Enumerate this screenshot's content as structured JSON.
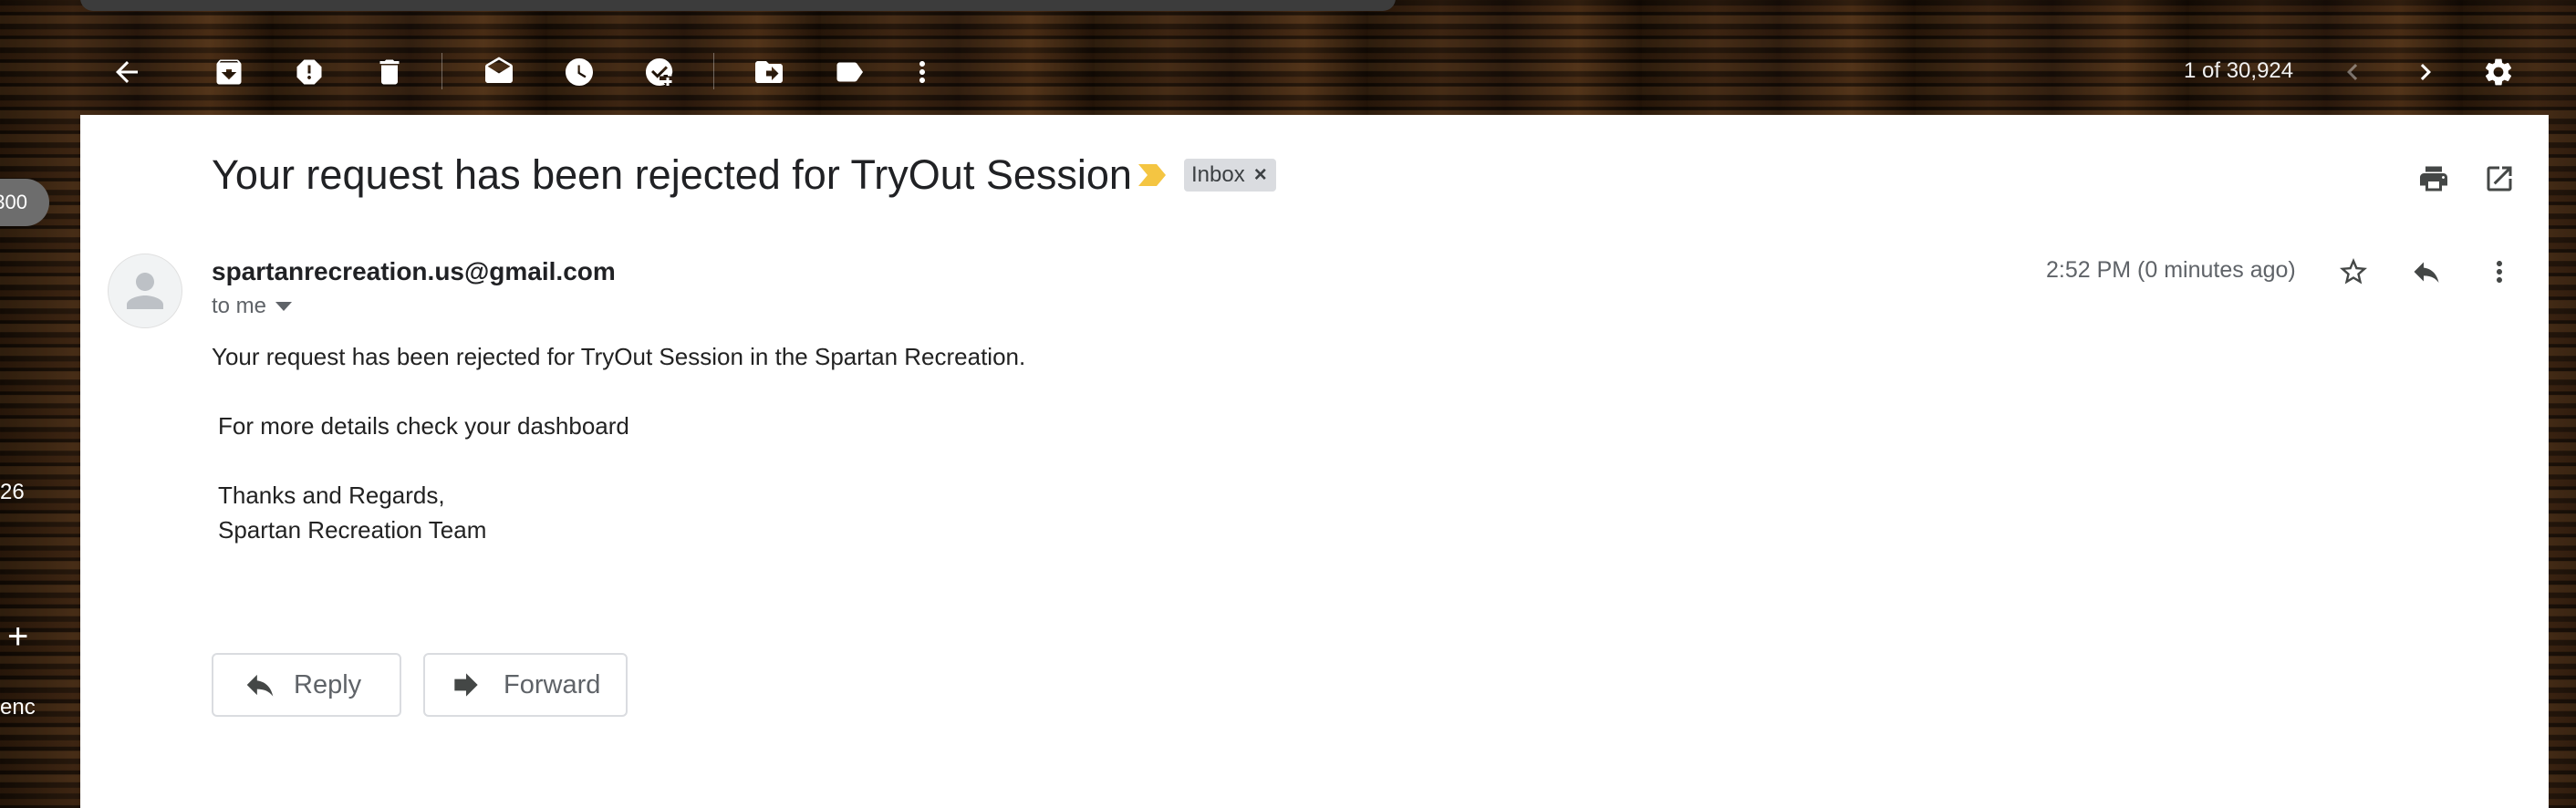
{
  "toolbar": {
    "icons": [
      "back-arrow-icon",
      "archive-icon",
      "report-spam-icon",
      "delete-icon",
      "mark-unread-icon",
      "snooze-icon",
      "add-to-tasks-icon",
      "move-to-icon",
      "labels-icon",
      "more-vert-icon"
    ],
    "pager": "1 of 30,924",
    "settings_icon": "gear-icon"
  },
  "sidebar": {
    "pill_count": "300",
    "count_26": "26",
    "partial_label": "enc"
  },
  "message": {
    "subject": "Your request has been rejected for TryOut Session",
    "label": "Inbox",
    "label_remove": "×",
    "sender": "spartanrecreation.us@gmail.com",
    "recipient": "to me",
    "time": "2:52 PM (0 minutes ago)",
    "body": {
      "line1": "Your request has been rejected for TryOut Session in the Spartan Recreation.",
      "line2": "For more details check your dashboard",
      "line3": "Thanks and Regards,",
      "line4": "Spartan Recreation Team"
    },
    "reply_label": "Reply",
    "forward_label": "Forward"
  },
  "colors": {
    "label_chip_bg": "#dadce0",
    "importance_marker": "#f4c542",
    "card_bg": "#ffffff"
  }
}
